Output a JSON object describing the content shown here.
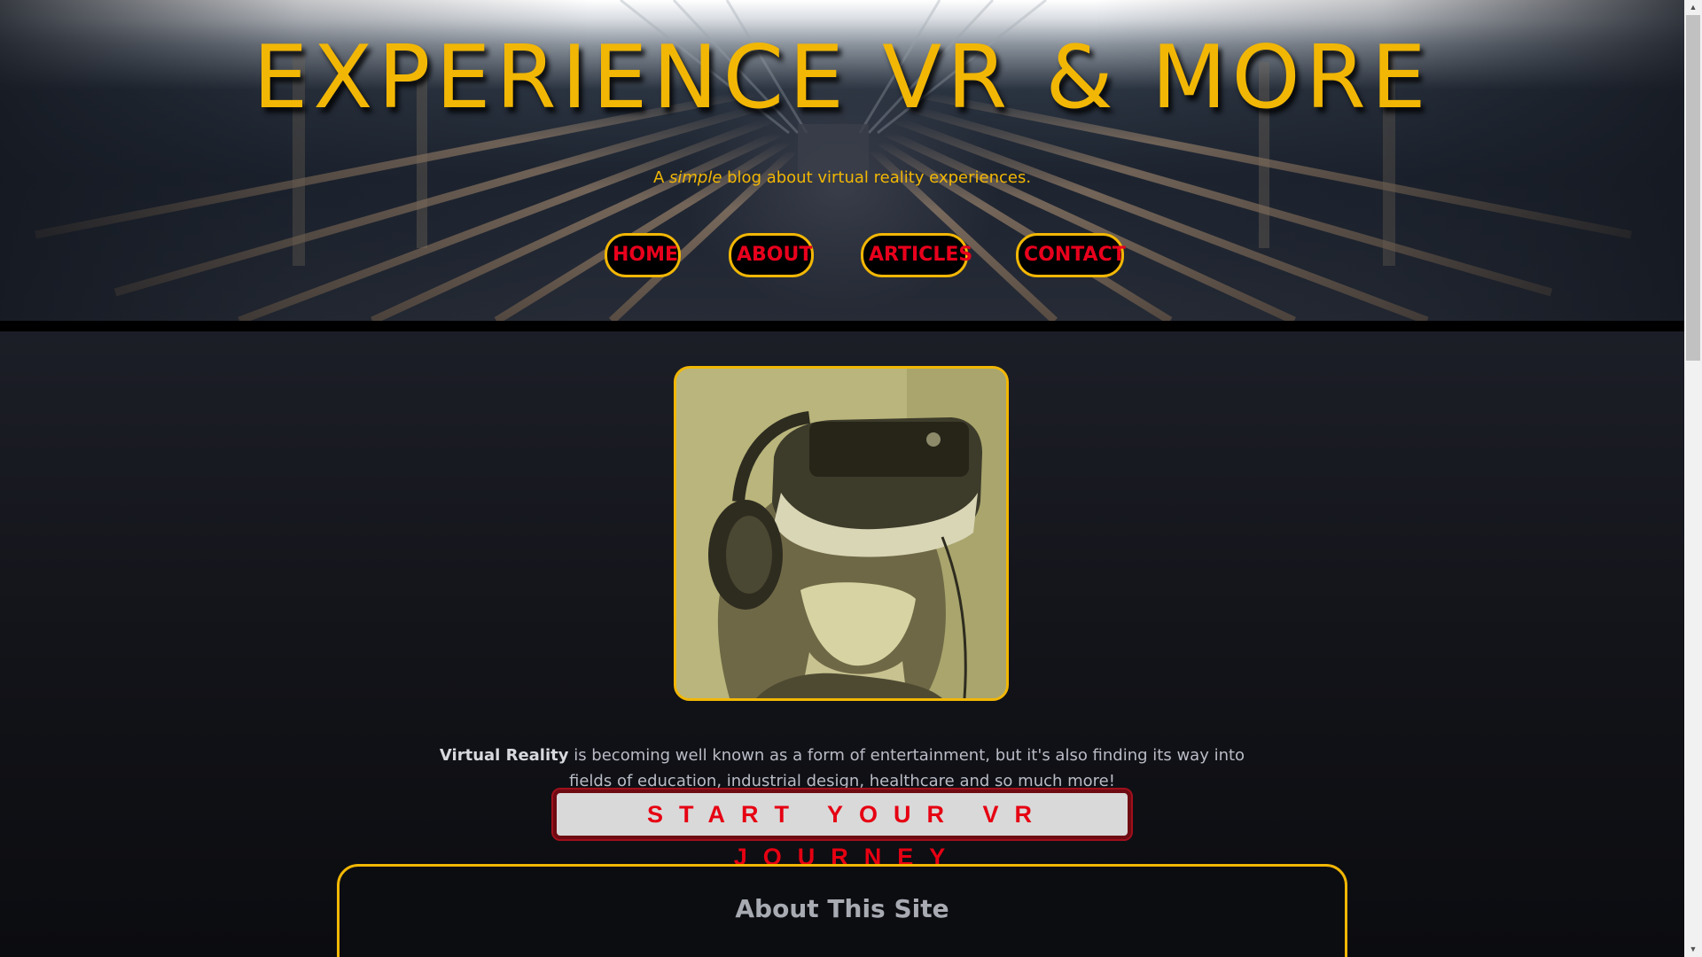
{
  "site": {
    "title": "EXPERIENCE VR & MORE",
    "tagline_pre": "A ",
    "tagline_em": "simple",
    "tagline_post": " blog about virtual reality experiences."
  },
  "nav": {
    "items": [
      {
        "label": "HOME"
      },
      {
        "label": "ABOUT"
      },
      {
        "label": "ARTICLES"
      },
      {
        "label": "CONTACT"
      }
    ]
  },
  "main": {
    "intro_strong": "Virtual Reality",
    "intro_text": " is becoming well known as a form of entertainment, but it's also finding its way into fields of education, industrial design, healthcare and so much more!",
    "cta_label": "START YOUR VR JOURNEY",
    "about_title": "About This Site"
  },
  "colors": {
    "accent_gold": "#f2b705",
    "nav_text_red": "#e8001c",
    "cta_text_red": "#e60012",
    "background_dark": "#121318"
  },
  "icons": {
    "scroll_up": "arrow-up-icon",
    "scroll_down": "arrow-down-icon"
  }
}
